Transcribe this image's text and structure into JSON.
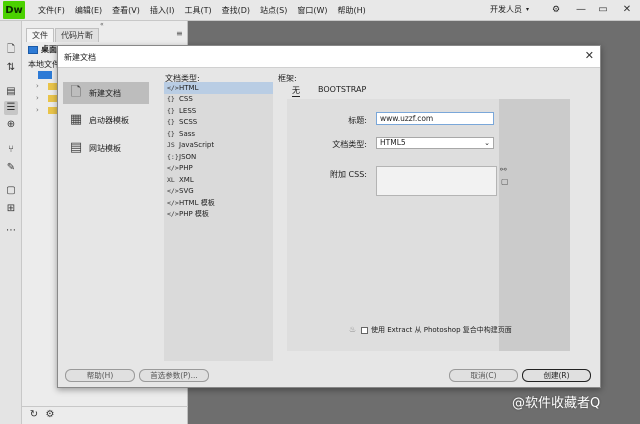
{
  "app": {
    "logo": "Dw",
    "menu": [
      "文件(F)",
      "编辑(E)",
      "查看(V)",
      "插入(I)",
      "工具(T)",
      "查找(D)",
      "站点(S)",
      "窗口(W)",
      "帮助(H)"
    ],
    "workspace": "开发人员",
    "workspace_caret": "▾",
    "window_controls": {
      "minimize": "—",
      "restore": "▭",
      "close": "✕"
    }
  },
  "files_panel": {
    "grip": "«",
    "tabs": [
      "文件",
      "代码片断"
    ],
    "menu": "≡",
    "drive": "桌面",
    "local_label": "本地文件",
    "tree_arrows": [
      "›",
      "›",
      "›"
    ]
  },
  "dialog": {
    "title": "新建文档",
    "close": "✕",
    "sidebar": [
      {
        "label": "新建文档",
        "icon": "document-icon"
      },
      {
        "label": "启动器模板",
        "icon": "starter-template-icon"
      },
      {
        "label": "网站模板",
        "icon": "site-template-icon"
      }
    ],
    "doc_type_label": "文档类型:",
    "doc_types": [
      {
        "icon": "</>",
        "label": "HTML"
      },
      {
        "icon": "{}",
        "label": "CSS"
      },
      {
        "icon": "{}",
        "label": "LESS"
      },
      {
        "icon": "{}",
        "label": "SCSS"
      },
      {
        "icon": "{}",
        "label": "Sass"
      },
      {
        "icon": "JS",
        "label": "JavaScript"
      },
      {
        "icon": "{:}",
        "label": "JSON"
      },
      {
        "icon": "</>",
        "label": "PHP"
      },
      {
        "icon": "XL",
        "label": "XML"
      },
      {
        "icon": "</>",
        "label": "SVG"
      },
      {
        "icon": "</>",
        "label": "HTML 模板"
      },
      {
        "icon": "</>",
        "label": "PHP 模板"
      }
    ],
    "frame_label": "框架:",
    "frame_tabs": [
      "无",
      "BOOTSTRAP"
    ],
    "form": {
      "title_label": "标题:",
      "title_value": "www.uzzf.com",
      "doctype_label": "文档类型:",
      "doctype_value": "HTML5",
      "caret": "⌄",
      "css_label": "附加 CSS:",
      "link_icon": "⚯",
      "extract_text": "使用 Extract 从 Photoshop 复合中构建页面"
    },
    "buttons": {
      "help": "帮助(H)",
      "prefs": "首选参数(P)...",
      "cancel": "取消(C)",
      "create": "创建(R)"
    }
  },
  "watermark": "@软件收藏者Q"
}
